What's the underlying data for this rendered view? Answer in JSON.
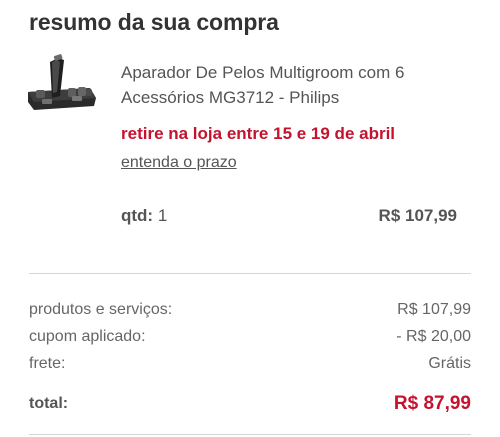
{
  "summary_title": "resumo da sua compra",
  "product": {
    "image_icon": "hair-trimmer-kit-icon",
    "name": "Aparador De Pelos Multigroom com 6 Acessórios MG3712 - Philips",
    "pickup_text": "retire na loja entre 15 e 19 de abril",
    "deadline_link": "entenda o prazo",
    "qty_label": "qtd:",
    "qty_value": "1",
    "price": "R$ 107,99"
  },
  "totals": {
    "products_label": "produtos e serviços:",
    "products_value": "R$ 107,99",
    "coupon_label": "cupom aplicado:",
    "coupon_value": "- R$ 20,00",
    "shipping_label": "frete:",
    "shipping_value": "Grátis",
    "total_label": "total:",
    "total_value": "R$ 87,99"
  },
  "colors": {
    "accent_red": "#c4122f",
    "text": "#555555",
    "divider": "#d6d6d6"
  }
}
